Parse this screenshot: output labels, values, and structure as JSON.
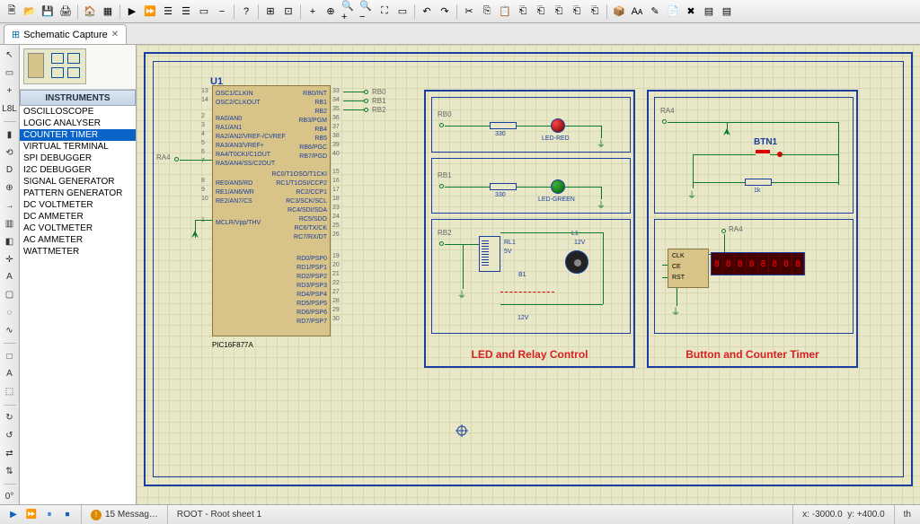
{
  "toolbar_groups": [
    [
      "new-file-icon",
      "open-icon",
      "save-icon",
      "print-icon"
    ],
    [
      "home-icon",
      "component-icon"
    ],
    [
      "play-icon",
      "step-icon",
      "list1-icon",
      "list2-icon",
      "sheet-icon",
      "minus-icon"
    ],
    [
      "help-icon"
    ],
    [
      "grid-icon",
      "options-icon"
    ],
    [
      "zoom-in-icon",
      "zoom-to-icon",
      "zoom-in2-icon",
      "zoom-out-icon",
      "zoom-fit-icon",
      "zoom-sheet-icon"
    ],
    [
      "undo-icon",
      "redo-icon"
    ],
    [
      "cut-icon",
      "copy-icon",
      "paste-icon",
      "paste2-icon",
      "paste3-icon",
      "paste4-icon",
      "paste5-icon",
      "paste6-icon"
    ],
    [
      "pkg-icon",
      "lib-icon",
      "ruler-icon",
      "doc-icon",
      "x-icon",
      "page1-icon",
      "page2-icon"
    ]
  ],
  "toolbar_glyphs": {
    "new-file-icon": "🗎",
    "open-icon": "📂",
    "save-icon": "💾",
    "print-icon": "🖨",
    "home-icon": "🏠",
    "component-icon": "▦",
    "play-icon": "▶",
    "step-icon": "⏩",
    "list1-icon": "☰",
    "list2-icon": "☰",
    "sheet-icon": "▭",
    "minus-icon": "−",
    "help-icon": "?",
    "grid-icon": "⊞",
    "options-icon": "⊡",
    "zoom-in-icon": "+",
    "zoom-to-icon": "⊕",
    "zoom-in2-icon": "🔍+",
    "zoom-out-icon": "🔍−",
    "zoom-fit-icon": "⛶",
    "zoom-sheet-icon": "▭",
    "undo-icon": "↶",
    "redo-icon": "↷",
    "cut-icon": "✂",
    "copy-icon": "⎘",
    "paste-icon": "📋",
    "paste2-icon": "⎗",
    "paste3-icon": "⎗",
    "paste4-icon": "⎗",
    "paste5-icon": "⎗",
    "paste6-icon": "⎗",
    "pkg-icon": "📦",
    "lib-icon": "Aᴀ",
    "ruler-icon": "✎",
    "doc-icon": "📄",
    "x-icon": "✖",
    "page1-icon": "▤",
    "page2-icon": "▤"
  },
  "tab": {
    "title": "Schematic Capture",
    "close": "✕"
  },
  "side_tools": [
    "↖",
    "▭",
    "+",
    "L8L",
    "—",
    "▮",
    "⟲",
    "D",
    "⊕",
    "→",
    "▥",
    "◧",
    "✛",
    "A",
    "▢",
    "◌",
    "∿",
    "—",
    "□",
    "A",
    "⬚",
    "—",
    "↻",
    "↺",
    "⇄",
    "⇅",
    "—",
    "0°"
  ],
  "panel": {
    "header": "INSTRUMENTS",
    "items": [
      "OSCILLOSCOPE",
      "LOGIC ANALYSER",
      "COUNTER TIMER",
      "VIRTUAL TERMINAL",
      "SPI DEBUGGER",
      "I2C DEBUGGER",
      "SIGNAL GENERATOR",
      "PATTERN GENERATOR",
      "DC VOLTMETER",
      "DC AMMETER",
      "AC VOLTMETER",
      "AC AMMETER",
      "WATTMETER"
    ],
    "selected": 2
  },
  "schematic": {
    "u1": {
      "ref": "U1",
      "part": "PIC16F877A",
      "left_nums": [
        "13",
        "14",
        "2",
        "3",
        "4",
        "5",
        "6",
        "7",
        "8",
        "9",
        "10",
        "1"
      ],
      "left_lbls": [
        "OSC1/CLKIN",
        "OSC2/CLKOUT",
        "RA0/AN0",
        "RA1/AN1",
        "RA2/AN2/VREF-/CVREF",
        "RA3/AN3/VREF+",
        "RA4/T0CKI/C1OUT",
        "RA5/AN4/SS/C2OUT",
        "RE0/AN5/RD",
        "RE1/AN6/WR",
        "RE2/AN7/CS",
        "MCLR/Vpp/THV"
      ],
      "right_nums": [
        "33",
        "34",
        "35",
        "36",
        "37",
        "38",
        "39",
        "40",
        "15",
        "16",
        "17",
        "18",
        "23",
        "24",
        "25",
        "26",
        "19",
        "20",
        "21",
        "22",
        "27",
        "28",
        "29",
        "30"
      ],
      "right_lbls": [
        "RB0/INT",
        "RB1",
        "RB2",
        "RB3/PGM",
        "RB4",
        "RB5",
        "RB6/PGC",
        "RB7/PGD",
        "RC0/T1OSO/T1CKI",
        "RC1/T1OSI/CCP2",
        "RC2/CCP1",
        "RC3/SCK/SCL",
        "RC4/SDI/SDA",
        "RC5/SDO",
        "RC6/TX/CK",
        "RC7/RX/DT",
        "RD0/PSP0",
        "RD1/PSP1",
        "RD2/PSP2",
        "RD3/PSP3",
        "RD4/PSP4",
        "RD5/PSP5",
        "RD6/PSP6",
        "RD7/PSP7"
      ],
      "ra4_net": "RA4",
      "rb_nets": [
        "RB0",
        "RB1",
        "RB2"
      ]
    },
    "box_led": {
      "title": "LED and Relay Control",
      "rb0": "RB0",
      "rb1": "RB1",
      "rb2": "RB2",
      "r330": "330",
      "led_red": "LED-RED",
      "led_green": "LED-GREEN",
      "relay": "RL1",
      "relay_v": "5V",
      "batt": "B1",
      "batt_v": "12V",
      "lamp": "L1",
      "lamp_v": "12V"
    },
    "box_btn": {
      "title": "Button and Counter Timer",
      "ra4": "RA4",
      "btn": "BTN1",
      "r1k": "1k",
      "ctr_pins": [
        "CLK",
        "CE",
        "RST"
      ]
    }
  },
  "status": {
    "messages": "15 Messag…",
    "sheet": "ROOT - Root sheet 1",
    "coords_x": "-3000.0",
    "coords_y": "+400.0",
    "units": "th"
  }
}
